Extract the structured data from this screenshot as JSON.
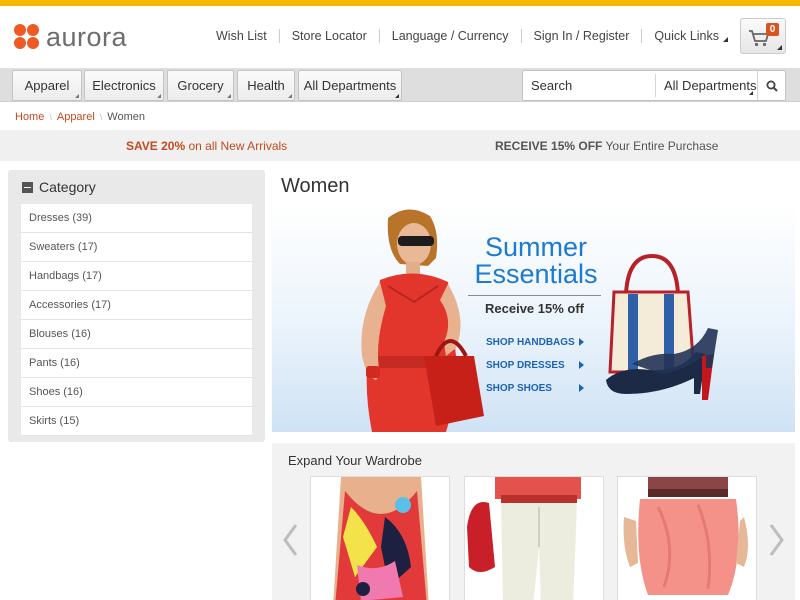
{
  "brand": {
    "name": "aurora",
    "accent": "#ef5a24",
    "top_bar_color": "#f5b800"
  },
  "header": {
    "links": [
      {
        "label": "Wish List"
      },
      {
        "label": "Store Locator"
      },
      {
        "label": "Language / Currency"
      },
      {
        "label": "Sign In / Register"
      },
      {
        "label": "Quick Links"
      }
    ],
    "cart": {
      "icon": "cart-icon",
      "count": "0"
    }
  },
  "nav": {
    "tabs": [
      {
        "label": "Apparel"
      },
      {
        "label": "Electronics"
      },
      {
        "label": "Grocery"
      },
      {
        "label": "Health"
      },
      {
        "label": "All Departments"
      }
    ],
    "search": {
      "placeholder": "Search",
      "department": "All Departments",
      "button_icon": "search-icon"
    }
  },
  "breadcrumb": {
    "items": [
      "Home",
      "Apparel",
      "Women"
    ]
  },
  "promo": {
    "left": {
      "highlight": "SAVE 20%",
      "text": "on all New Arrivals"
    },
    "right": {
      "highlight": "RECEIVE 15% OFF",
      "text": "Your Entire Purchase"
    }
  },
  "sidebar": {
    "title": "Category",
    "items": [
      {
        "label": "Dresses (39)"
      },
      {
        "label": "Sweaters (17)"
      },
      {
        "label": "Handbags (17)"
      },
      {
        "label": "Accessories (17)"
      },
      {
        "label": "Blouses (16)"
      },
      {
        "label": "Pants (16)"
      },
      {
        "label": "Shoes (16)"
      },
      {
        "label": "Skirts (15)"
      }
    ]
  },
  "main": {
    "title": "Women",
    "banner": {
      "title_line1": "Summer",
      "title_line2": "Essentials",
      "subtitle": "Receive 15% off",
      "links": [
        {
          "label": "SHOP HANDBAGS"
        },
        {
          "label": "SHOP DRESSES"
        },
        {
          "label": "SHOP SHOES"
        }
      ],
      "title_color": "#1b7ad1"
    },
    "wardrobe": {
      "title": "Expand Your Wardrobe"
    }
  }
}
